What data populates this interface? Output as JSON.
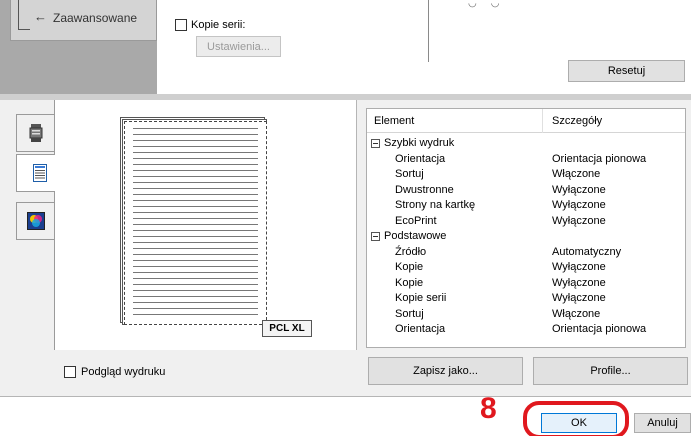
{
  "nav": {
    "back_label": "Zaawansowane",
    "back_icon": "back-arrow-icon"
  },
  "top": {
    "collate_label": "Kopie serii:",
    "settings_label": "Ustawienia...",
    "reset_label": "Resetuj"
  },
  "side_tabs": [
    {
      "icon": "printer-icon"
    },
    {
      "icon": "document-icon"
    },
    {
      "icon": "color-icon"
    }
  ],
  "preview": {
    "badge": "PCL XL",
    "print_preview_label": "Podgląd wydruku"
  },
  "table": {
    "col_element": "Element",
    "col_details": "Szczegóły",
    "rows": [
      {
        "type": "group",
        "element": "Szybki wydruk",
        "detail": ""
      },
      {
        "type": "item",
        "element": "Orientacja",
        "detail": "Orientacja pionowa"
      },
      {
        "type": "item",
        "element": "Sortuj",
        "detail": "Włączone"
      },
      {
        "type": "item",
        "element": "Dwustronne",
        "detail": "Wyłączone"
      },
      {
        "type": "item",
        "element": "Strony na kartkę",
        "detail": "Wyłączone"
      },
      {
        "type": "item",
        "element": "EcoPrint",
        "detail": "Wyłączone"
      },
      {
        "type": "group",
        "element": "Podstawowe",
        "detail": ""
      },
      {
        "type": "item",
        "element": "Źródło",
        "detail": "Automatyczny"
      },
      {
        "type": "item",
        "element": "Kopie",
        "detail": "Wyłączone"
      },
      {
        "type": "item",
        "element": "Kopie",
        "detail": "Wyłączone"
      },
      {
        "type": "item",
        "element": "Kopie serii",
        "detail": "Wyłączone"
      },
      {
        "type": "item",
        "element": "Sortuj",
        "detail": "Włączone"
      },
      {
        "type": "item",
        "element": "Orientacja",
        "detail": "Orientacja pionowa"
      }
    ]
  },
  "buttons": {
    "save_as": "Zapisz jako...",
    "profiles": "Profile...",
    "ok": "OK",
    "cancel": "Anuluj"
  },
  "annotation": {
    "step": "8"
  },
  "colors": {
    "highlight": "#e0181e",
    "nav_bg": "#a9a9a9",
    "panel_bg": "#f0f0f0"
  }
}
